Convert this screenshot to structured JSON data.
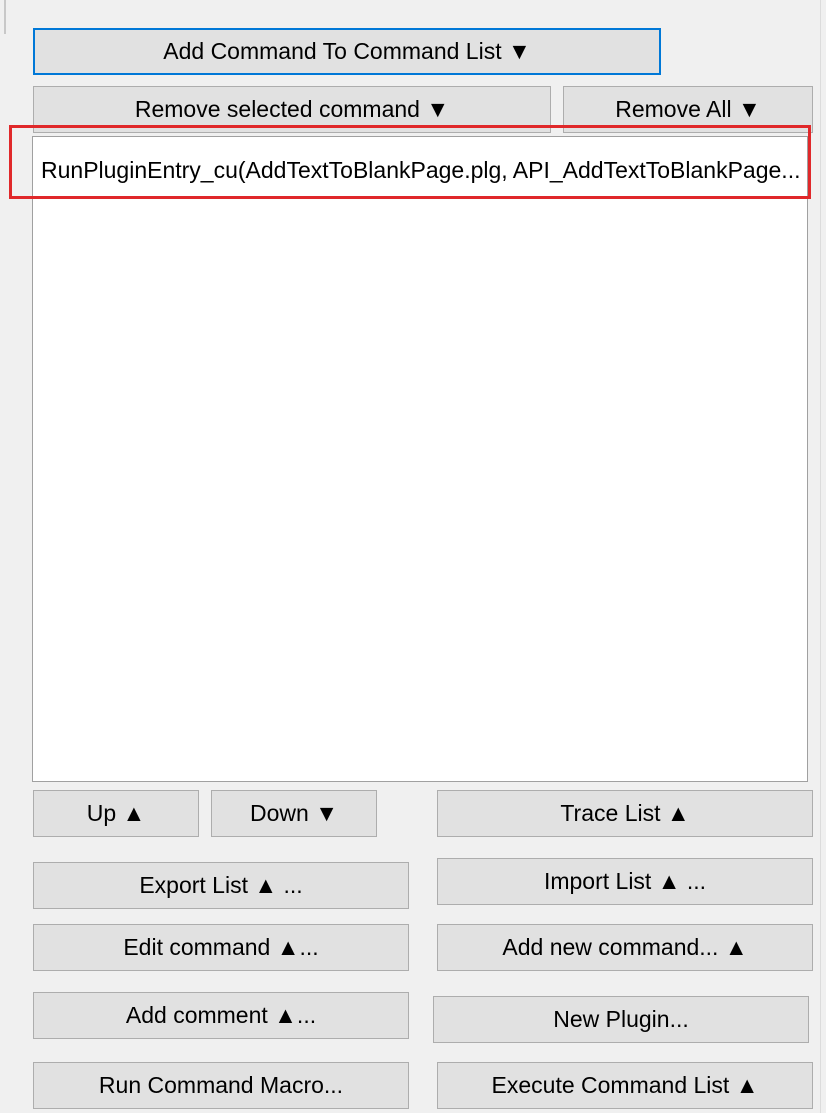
{
  "toolbar": {
    "add_command": "Add Command To Command List ▼",
    "remove_selected": "Remove selected command ▼",
    "remove_all": "Remove All ▼"
  },
  "command_list": {
    "items": [
      {
        "text": "RunPluginEntry_cu(AddTextToBlankPage.plg, API_AddTextToBlankPage..."
      }
    ],
    "selected_index": 0
  },
  "buttons": {
    "up": "Up ▲",
    "down": "Down ▼",
    "trace_list": "Trace List ▲",
    "export_list": "Export List ▲ ...",
    "import_list": "Import List ▲ ...",
    "edit_command": "Edit command ▲...",
    "add_new_command": "Add new command... ▲",
    "add_comment": "Add comment ▲...",
    "new_plugin": "New Plugin...",
    "run_command_macro": "Run Command Macro...",
    "execute_command_list": "Execute Command List ▲"
  },
  "colors": {
    "highlight_border": "#e0282a",
    "default_button_border": "#0078d7",
    "button_face": "#e1e1e1",
    "panel_background": "#f0f0f0"
  }
}
